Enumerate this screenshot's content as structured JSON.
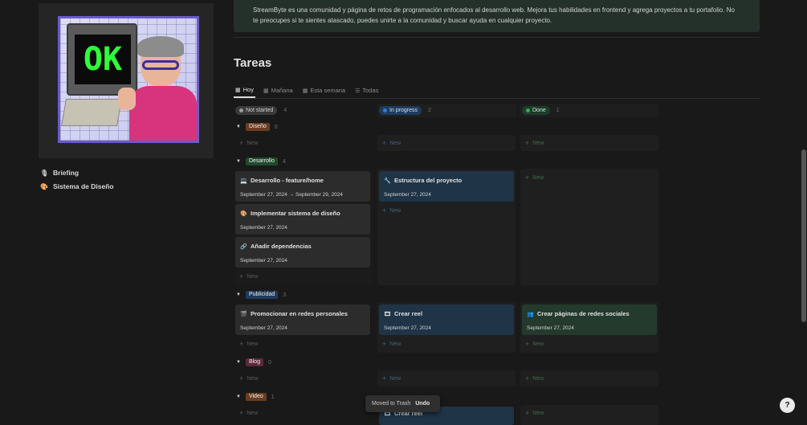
{
  "sidebar": {
    "gif_text": "OK",
    "items": [
      {
        "icon": "microphone-icon",
        "glyph": "🎙",
        "label": "Briefing"
      },
      {
        "icon": "palette-icon",
        "glyph": "🎨",
        "label": "Sistema de Diseño"
      }
    ]
  },
  "description": "StreamByte es una comunidad y página de retos de programación enfocados al desarrollo web. Mejora tus habilidades en frontend y agrega proyectos a tu portafolio. No te preocupes si te sientes atascado, puedes unirte a la comunidad y buscar ayuda en cualquier proyecto.",
  "title": "Tareas",
  "views": [
    {
      "label": "Hoy",
      "glyph": "▦",
      "active": true
    },
    {
      "label": "Mañana",
      "glyph": "▦",
      "active": false
    },
    {
      "label": "Esta semana",
      "glyph": "▦",
      "active": false
    },
    {
      "label": "Todas",
      "glyph": "☰",
      "active": false
    }
  ],
  "columns": [
    {
      "label": "Not started",
      "count": "4",
      "bg": "#3a3a3a",
      "dot": "#9b9b9b"
    },
    {
      "label": "In progress",
      "count": "2",
      "bg": "#1f3b5c",
      "dot": "#2e7cd6"
    },
    {
      "label": "Done",
      "count": "1",
      "bg": "#1e3c2a",
      "dot": "#3aa55c"
    }
  ],
  "new_label": "New",
  "groups": [
    {
      "label": "Diseño",
      "count": "0",
      "color": "#6b3d1f"
    },
    {
      "label": "Desarrollo",
      "count": "4",
      "color": "#1f4a2e"
    },
    {
      "label": "Publicidad",
      "count": "3",
      "color": "#1f3b5c"
    },
    {
      "label": "Blog",
      "count": "0",
      "color": "#5a2a3a"
    },
    {
      "label": "Video",
      "count": "1",
      "color": "#6b3d1f"
    }
  ],
  "cards": {
    "desarrollo_not_started": [
      {
        "glyph": "💻",
        "title": "Desarrollo - feature/home",
        "date": "September 27, 2024 → September 29, 2024"
      },
      {
        "glyph": "🎨",
        "title": "Implementar sistema de diseño",
        "date": "September 27, 2024"
      },
      {
        "glyph": "🔗",
        "title": "Añadir dependencias",
        "date": "September 27, 2024"
      }
    ],
    "desarrollo_in_progress": [
      {
        "glyph": "🔧",
        "title": "Estructura del proyecto",
        "date": "September 27, 2024"
      }
    ],
    "publicidad_not_started": [
      {
        "glyph": "🎬",
        "title": "Promocionar en redes personales",
        "date": "September 27, 2024"
      }
    ],
    "publicidad_in_progress": [
      {
        "glyph": "🎞",
        "title": "Crear reel",
        "date": "September 27, 2024"
      }
    ],
    "publicidad_done": [
      {
        "glyph": "👥",
        "title": "Crear páginas de redes sociales",
        "date": "September 27, 2024"
      }
    ],
    "video_in_progress": [
      {
        "glyph": "🎞",
        "title": "Crear reel"
      }
    ]
  },
  "toast": {
    "message": "Moved to Trash",
    "action": "Undo"
  },
  "help_glyph": "?"
}
